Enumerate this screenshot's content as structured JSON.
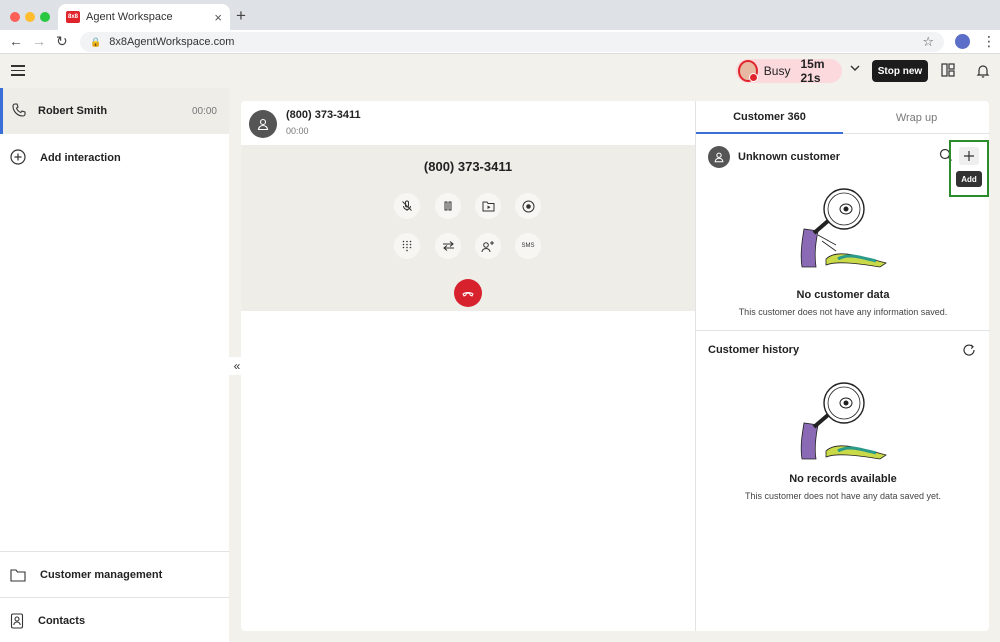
{
  "browser": {
    "tab_title": "Agent Workspace",
    "favicon_text": "8x8",
    "url": "8x8AgentWorkspace.com"
  },
  "header": {
    "status": "Busy",
    "status_timer": "15m 21s",
    "stop_new_label": "Stop new"
  },
  "sidebar": {
    "active_interaction": {
      "name": "Robert Smith",
      "time": "00:00"
    },
    "add_interaction_label": "Add interaction",
    "bottom_items": [
      {
        "label": "Customer management",
        "icon": "folder-icon"
      },
      {
        "label": "Contacts",
        "icon": "contacts-icon"
      }
    ]
  },
  "call": {
    "header_number": "(800) 373-3411",
    "header_duration": "00:00",
    "display_number": "(800) 373-3411",
    "controls_row1": [
      "mute-icon",
      "hold-icon",
      "voicemail-icon",
      "record-icon"
    ],
    "controls_row2": [
      "dialpad-icon",
      "transfer-icon",
      "add-participant-icon",
      "sms-icon"
    ],
    "sms_label": "SMS"
  },
  "customer360": {
    "tabs": [
      "Customer 360",
      "Wrap up"
    ],
    "customer_name": "Unknown customer",
    "add_tooltip": "Add",
    "no_data_title": "No customer data",
    "no_data_desc": "This customer does not have any information saved.",
    "history_title": "Customer history",
    "no_records_title": "No records available",
    "no_records_desc": "This customer does not have any data saved yet."
  },
  "colors": {
    "accent_blue": "#3b6fd8",
    "busy_pill": "#fbd9dd",
    "hangup_red": "#d7222e",
    "highlight_green": "#2a8c2a"
  }
}
